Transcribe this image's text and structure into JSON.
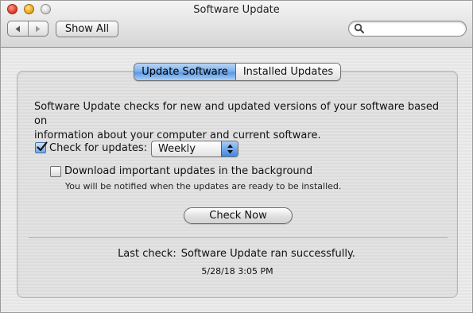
{
  "window": {
    "title": "Software Update"
  },
  "toolbar": {
    "back_icon": "left-arrow-icon",
    "forward_icon": "right-arrow-icon",
    "show_all_label": "Show All",
    "search_value": ""
  },
  "tabs": [
    {
      "label": "Update Software",
      "active": true
    },
    {
      "label": "Installed Updates",
      "active": false
    }
  ],
  "content": {
    "description_line1": "Software Update checks for new and updated versions of your software based on",
    "description_line2": "information about your computer and current software.",
    "check_for_updates": {
      "label": "Check for updates:",
      "checked": true
    },
    "frequency": {
      "selected": "Weekly"
    },
    "download_background": {
      "label": "Download important updates in the background",
      "checked": false,
      "note": "You will be notified when the updates are ready to be installed."
    },
    "check_now_label": "Check Now",
    "last_check": {
      "label": "Last check:",
      "status": "Software Update ran successfully.",
      "datetime": "5/28/18 3:05 PM"
    }
  },
  "colors": {
    "accent": "#6aa6ee",
    "close": "#e0402c",
    "minimize": "#f0a820",
    "zoom": "#d8d8d8"
  }
}
